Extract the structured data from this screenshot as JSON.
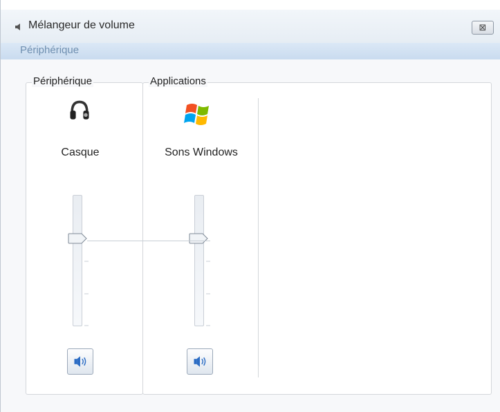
{
  "window": {
    "title": "Mélangeur de volume",
    "close_label": "⊠"
  },
  "menubar": {
    "items": [
      "Périphérique"
    ]
  },
  "device_group": {
    "label": "Périphérique",
    "channel": {
      "name": "Casque",
      "icon": "headphones-icon",
      "volume_level": 0.67,
      "mute_icon": "speaker-icon"
    }
  },
  "apps_group": {
    "label": "Applications",
    "channels": [
      {
        "name": "Sons Windows",
        "icon": "windows-logo-icon",
        "volume_level": 0.67,
        "mute_icon": "speaker-icon"
      }
    ]
  },
  "colors": {
    "menubar_bg": "#c9dbef",
    "menu_text": "#6f8fb0",
    "accent": "#2b6cc4"
  }
}
